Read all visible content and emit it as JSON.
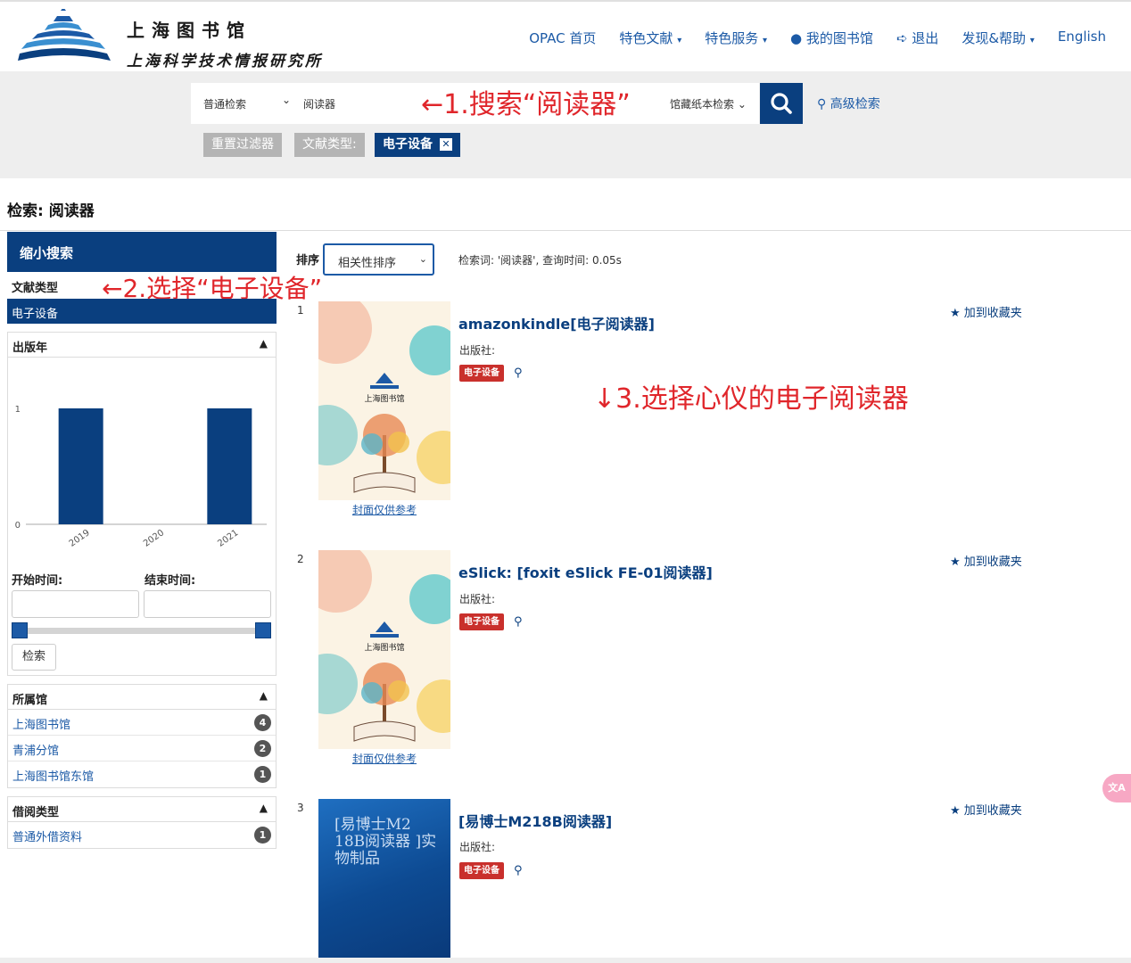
{
  "header": {
    "logo_line1": "上海图书馆",
    "logo_line2": "上海科学技术情报研究所",
    "nav": {
      "opac": "OPAC 首页",
      "special_docs": "特色文献",
      "special_services": "特色服务",
      "my_library": "我的图书馆",
      "logout": "退出",
      "discover_help": "发现&帮助",
      "english": "English"
    }
  },
  "search": {
    "type": "普通检索",
    "query": "阅读器",
    "scope": "馆藏纸本检索",
    "advanced": "高级检索",
    "reset_filters": "重置过滤器",
    "doc_type_label": "文献类型:",
    "doc_type_value": "电子设备"
  },
  "annotations": {
    "step1": "←1.搜索“阅读器”",
    "step2": "←2.选择“电子设备”",
    "step3": "↓3.选择心仪的电子阅读器"
  },
  "page_title": "检索: 阅读器",
  "sidebar": {
    "narrow": "缩小搜索",
    "doc_type": "文献类型",
    "selected": "电子设备",
    "pub_year": {
      "title": "出版年",
      "y_ticks": [
        "0",
        "1"
      ],
      "start_label": "开始时间:",
      "end_label": "结束时间:",
      "search_btn": "检索"
    },
    "branch": {
      "title": "所属馆",
      "items": [
        {
          "label": "上海图书馆",
          "count": "4"
        },
        {
          "label": "青浦分馆",
          "count": "2"
        },
        {
          "label": "上海图书馆东馆",
          "count": "1"
        }
      ]
    },
    "loan": {
      "title": "借阅类型",
      "items": [
        {
          "label": "普通外借资料",
          "count": "1"
        }
      ]
    }
  },
  "results": {
    "sort_label": "排序",
    "sort_value": "相关性排序",
    "query_info": "检索词: '阅读器', 查询时间: 0.05s",
    "cover_caption": "封面仅供参考",
    "publisher_label": "出版社:",
    "badge": "电子设备",
    "fav": "加到收藏夹",
    "items": [
      {
        "num": "1",
        "title": "amazonkindle[电子阅读器]",
        "cover_text": "上海图书馆"
      },
      {
        "num": "2",
        "title": "eSlick: [foxit eSlick FE-01阅读器]",
        "cover_text": "上海图书馆"
      },
      {
        "num": "3",
        "title": "[易博士M218B阅读器]",
        "cover_text": "[易博士M2 18B阅读器 ]实物制品"
      }
    ]
  },
  "chart_data": {
    "type": "bar",
    "categories": [
      "2019",
      "2020",
      "2021"
    ],
    "values": [
      1,
      0,
      1
    ],
    "ylim": [
      0,
      1
    ],
    "title": "",
    "xlabel": "",
    "ylabel": ""
  },
  "floating_btn": "文A",
  "colors": {
    "brand": "#0a3f7f",
    "link": "#1c5aa6",
    "annotation": "#e0262b",
    "badge": "#c9302c"
  }
}
